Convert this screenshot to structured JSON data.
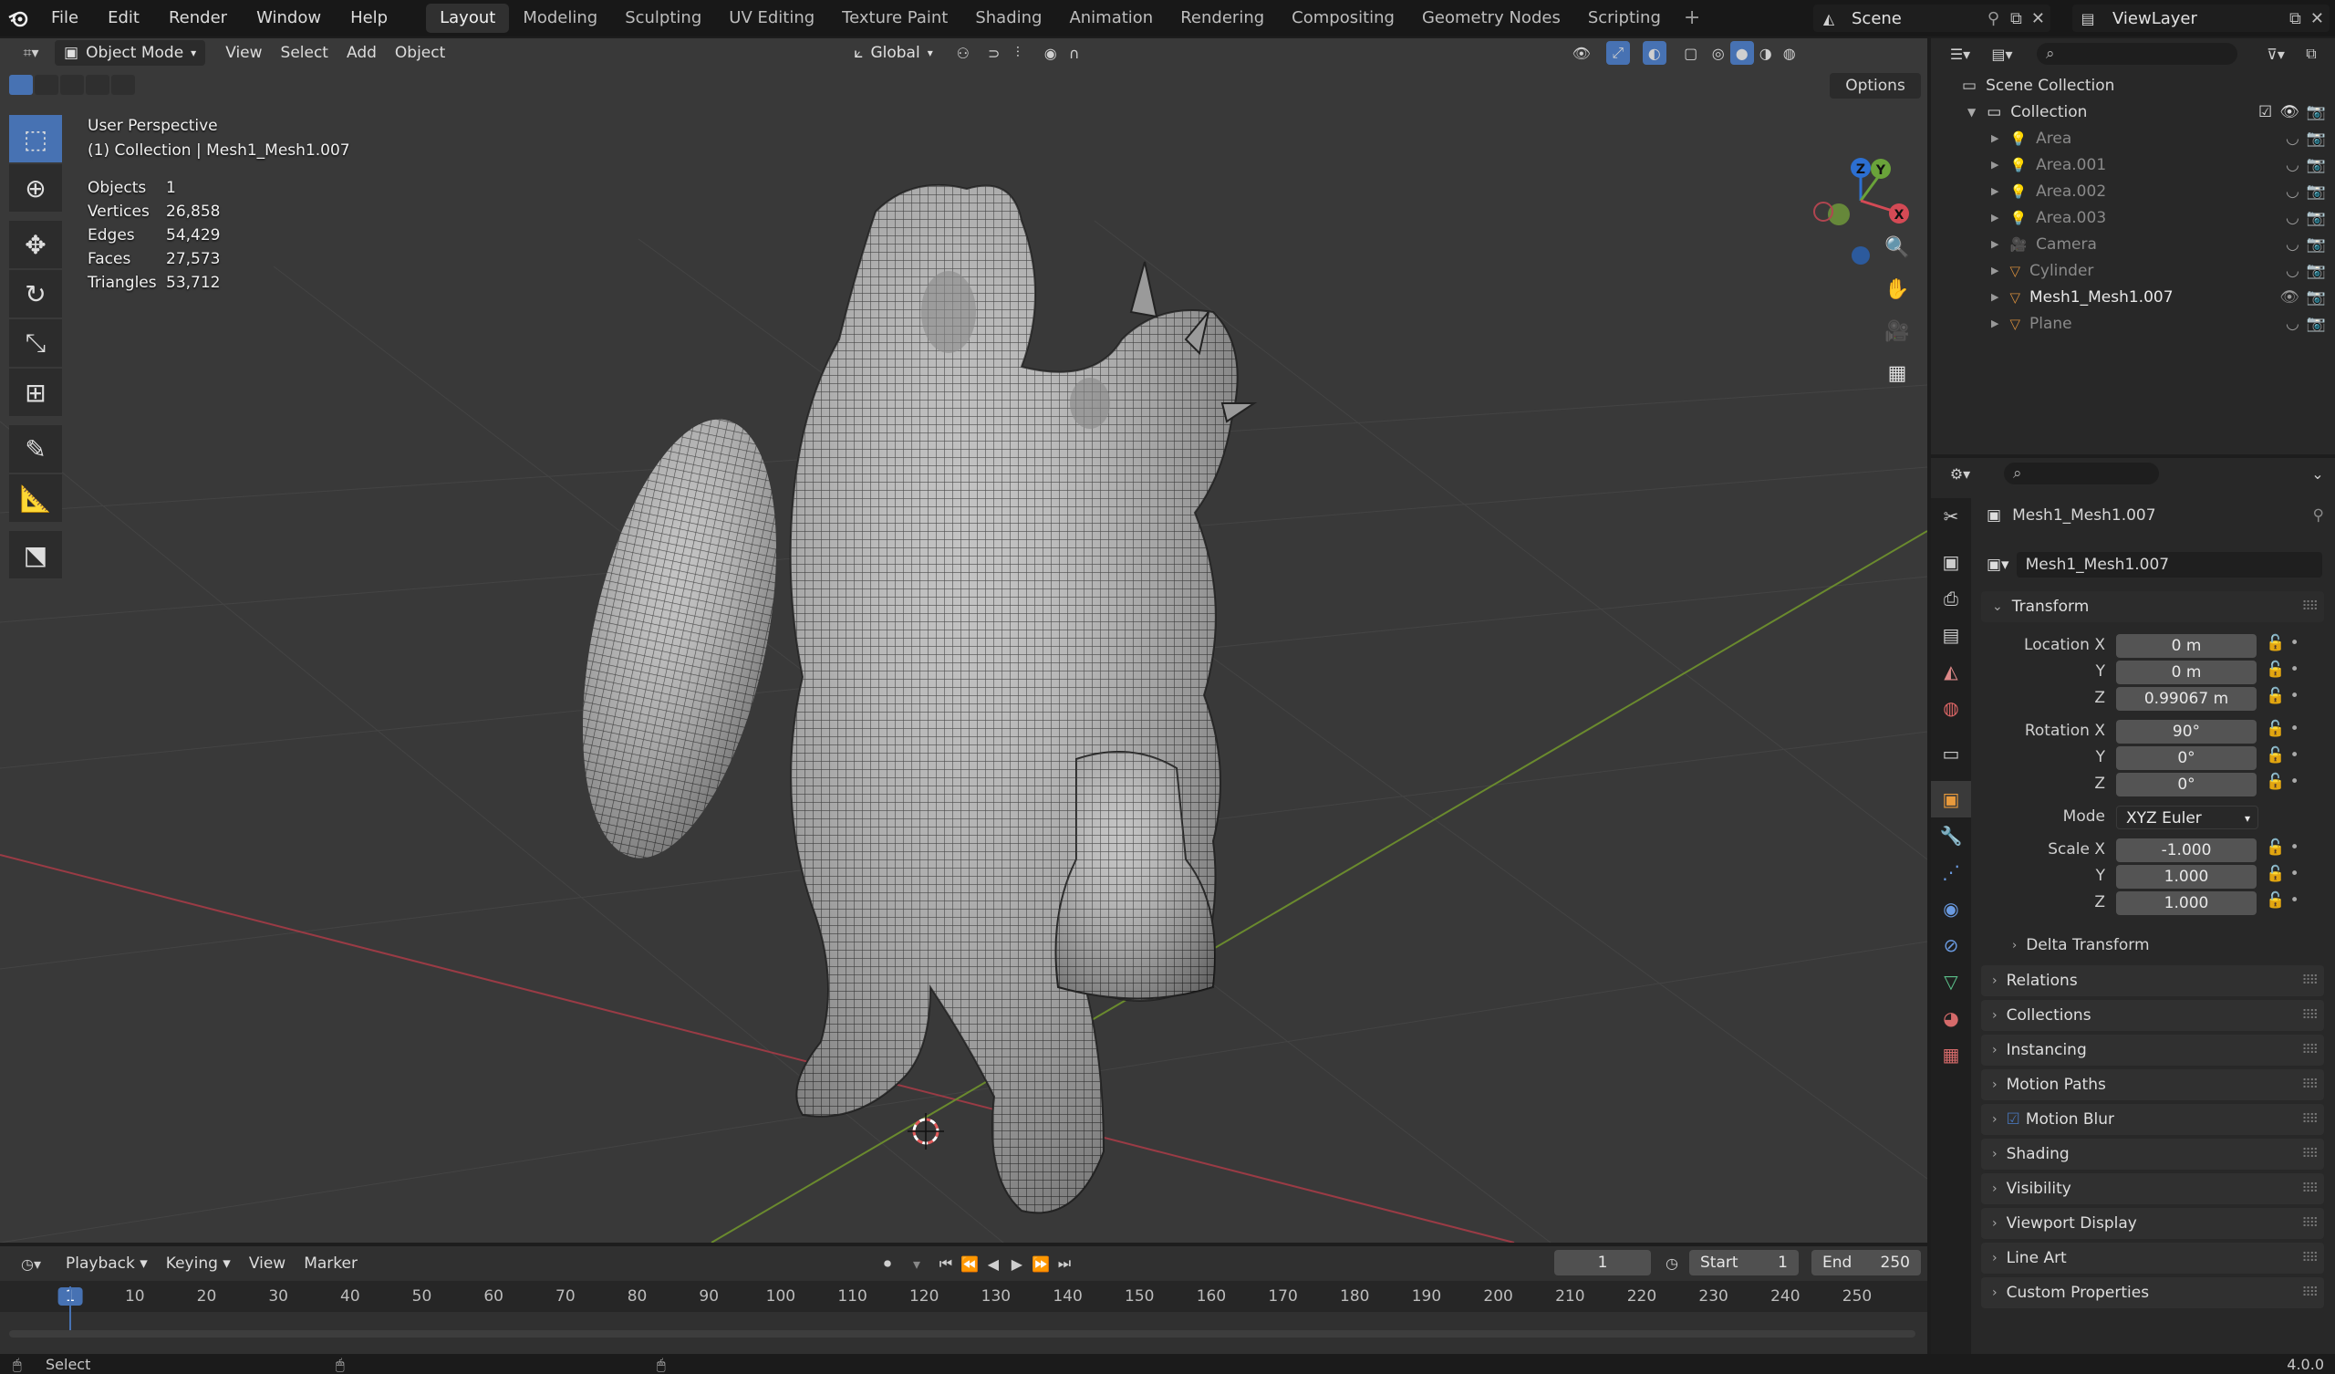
{
  "topbar": {
    "menus": [
      "File",
      "Edit",
      "Render",
      "Window",
      "Help"
    ],
    "workspaces": [
      "Layout",
      "Modeling",
      "Sculpting",
      "UV Editing",
      "Texture Paint",
      "Shading",
      "Animation",
      "Rendering",
      "Compositing",
      "Geometry Nodes",
      "Scripting"
    ],
    "active_workspace": "Layout",
    "scene": "Scene",
    "view_layer": "ViewLayer"
  },
  "viewport": {
    "mode": "Object Mode",
    "menus": [
      "View",
      "Select",
      "Add",
      "Object"
    ],
    "orientation": "Global",
    "options_label": "Options",
    "view_name": "User Perspective",
    "collection_line": "(1) Collection | Mesh1_Mesh1.007",
    "stats": [
      {
        "label": "Objects",
        "value": "1"
      },
      {
        "label": "Vertices",
        "value": "26,858"
      },
      {
        "label": "Edges",
        "value": "54,429"
      },
      {
        "label": "Faces",
        "value": "27,573"
      },
      {
        "label": "Triangles",
        "value": "53,712"
      }
    ],
    "gizmo_labels": {
      "z": "Z",
      "y": "Y",
      "x": "X"
    }
  },
  "outliner": {
    "root": "Scene Collection",
    "collection": "Collection",
    "items": [
      {
        "name": "Area",
        "icon": "light-icon"
      },
      {
        "name": "Area.001",
        "icon": "light-icon"
      },
      {
        "name": "Area.002",
        "icon": "light-icon"
      },
      {
        "name": "Area.003",
        "icon": "light-icon"
      },
      {
        "name": "Camera",
        "icon": "camera-icon"
      },
      {
        "name": "Cylinder",
        "icon": "mesh-icon"
      },
      {
        "name": "Mesh1_Mesh1.007",
        "icon": "mesh-icon"
      },
      {
        "name": "Plane",
        "icon": "mesh-icon"
      }
    ]
  },
  "properties": {
    "object_name": "Mesh1_Mesh1.007",
    "object_field": "Mesh1_Mesh1.007",
    "transform_label": "Transform",
    "location_label": "Location X",
    "rotation_label": "Rotation X",
    "scale_label": "Scale X",
    "axis_y": "Y",
    "axis_z": "Z",
    "location": [
      "0 m",
      "0 m",
      "0.99067 m"
    ],
    "rotation": [
      "90°",
      "0°",
      "0°"
    ],
    "mode_label": "Mode",
    "mode_value": "XYZ Euler",
    "scale": [
      "-1.000",
      "1.000",
      "1.000"
    ],
    "delta_transform": "Delta Transform",
    "panels": [
      "Relations",
      "Collections",
      "Instancing",
      "Motion Paths",
      "Motion Blur",
      "Shading",
      "Visibility",
      "Viewport Display",
      "Line Art",
      "Custom Properties"
    ]
  },
  "timeline": {
    "menus": [
      "Playback",
      "Keying",
      "View",
      "Marker"
    ],
    "current_frame": "1",
    "start_label": "Start",
    "start": "1",
    "end_label": "End",
    "end": "250",
    "ruler": [
      "1",
      "10",
      "20",
      "30",
      "40",
      "50",
      "60",
      "70",
      "80",
      "90",
      "100",
      "110",
      "120",
      "130",
      "140",
      "150",
      "160",
      "170",
      "180",
      "190",
      "200",
      "210",
      "220",
      "230",
      "240",
      "250"
    ]
  },
  "statusbar": {
    "left": "Select",
    "version": "4.0.0"
  }
}
